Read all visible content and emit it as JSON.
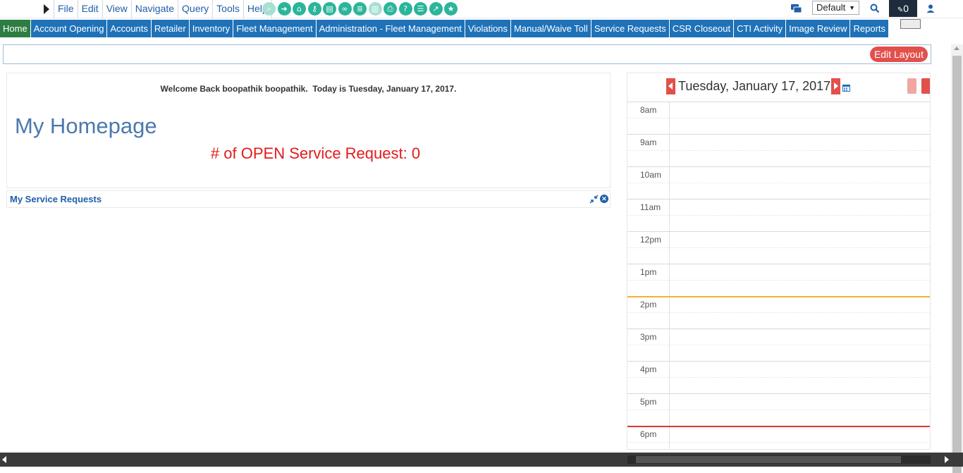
{
  "menubar": {
    "items": [
      "File",
      "Edit",
      "View",
      "Navigate",
      "Query",
      "Tools",
      "Help"
    ],
    "tool_icons": [
      {
        "name": "search-tool-icon",
        "glyph": "⌕",
        "dim": true
      },
      {
        "name": "go-icon",
        "glyph": "➜",
        "dim": false
      },
      {
        "name": "home-icon",
        "glyph": "⌂",
        "dim": false
      },
      {
        "name": "key-icon",
        "glyph": "⚷",
        "dim": false
      },
      {
        "name": "clipboard-icon",
        "glyph": "▤",
        "dim": false
      },
      {
        "name": "link-icon",
        "glyph": "∞",
        "dim": false
      },
      {
        "name": "list-icon",
        "glyph": "≣",
        "dim": false
      },
      {
        "name": "document-icon",
        "glyph": "▥",
        "dim": true
      },
      {
        "name": "print-icon",
        "glyph": "⎙",
        "dim": false
      },
      {
        "name": "help-icon",
        "glyph": "?",
        "dim": false
      },
      {
        "name": "notes-icon",
        "glyph": "☰",
        "dim": false
      },
      {
        "name": "chart-icon",
        "glyph": "↗",
        "dim": false
      },
      {
        "name": "star-icon",
        "glyph": "★",
        "dim": false
      }
    ],
    "layout_select": "Default",
    "notification_count": "0"
  },
  "nav": {
    "tabs": [
      "Home",
      "Account Opening",
      "Accounts",
      "Retailer",
      "Inventory",
      "Fleet Management",
      "Administration - Fleet Management",
      "Violations",
      "Manual/Waive Toll",
      "Service Requests",
      "CSR Closeout",
      "CTI Activity",
      "Image Review",
      "Reports"
    ],
    "active_index": 0
  },
  "layout_bar": {
    "edit_label": "Edit Layout"
  },
  "welcome": {
    "message": "Welcome Back boopathik boopathik.  Today is Tuesday, January 17, 2017.",
    "title": "My Homepage",
    "open_requests": "# of OPEN Service Request: 0"
  },
  "service_requests": {
    "title": "My Service Requests"
  },
  "calendar": {
    "date": "Tuesday, January 17, 2017",
    "hours": [
      "8am",
      "9am",
      "10am",
      "11am",
      "12pm",
      "1pm",
      "2pm",
      "3pm",
      "4pm",
      "5pm",
      "6pm"
    ]
  },
  "colors": {
    "nav_blue": "#1f72b8",
    "nav_active": "#2e7d43",
    "accent_red": "#e2504b",
    "tool_green": "#2bb59a"
  }
}
